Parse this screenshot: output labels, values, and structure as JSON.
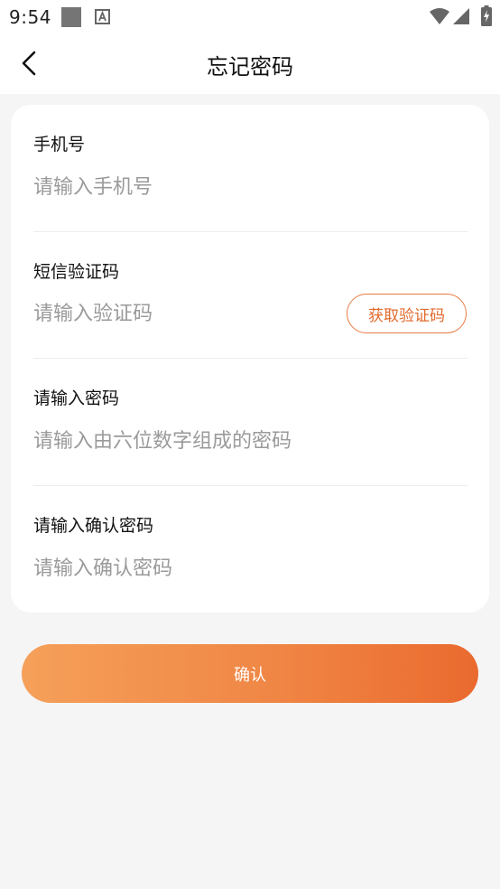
{
  "status_bar": {
    "time": "9:54"
  },
  "header": {
    "title": "忘记密码",
    "back_icon": "chevron-left-icon"
  },
  "form": {
    "phone": {
      "label": "手机号",
      "placeholder": "请输入手机号",
      "value": ""
    },
    "sms_code": {
      "label": "短信验证码",
      "placeholder": "请输入验证码",
      "value": "",
      "get_code_label": "获取验证码"
    },
    "password": {
      "label": "请输入密码",
      "placeholder": "请输入由六位数字组成的密码",
      "value": ""
    },
    "confirm_password": {
      "label": "请输入确认密码",
      "placeholder": "请输入确认密码",
      "value": ""
    }
  },
  "confirm_button": {
    "label": "确认"
  },
  "colors": {
    "accent": "#e26a2c",
    "gradient_start": "#f5a05a",
    "gradient_end": "#ea6a2e",
    "background": "#f5f5f6"
  }
}
